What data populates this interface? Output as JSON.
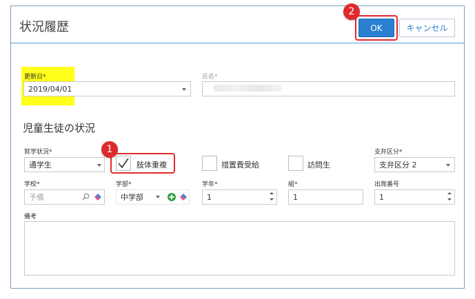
{
  "dialog": {
    "title": "状況履歴",
    "ok_label": "OK",
    "cancel_label": "キャンセル"
  },
  "annotations": {
    "badge_1": "1",
    "badge_2": "2",
    "highlight_color": "#ffff19",
    "marker_color": "#e0282b"
  },
  "form": {
    "update_date": {
      "label": "更新日*",
      "value": "2019/04/01"
    },
    "name": {
      "label": "氏名*",
      "value": ""
    },
    "section_title": "児童生徒の状況",
    "enrollment_status": {
      "label": "就学状況*",
      "value": "通学生"
    },
    "checkboxes": [
      {
        "label": "肢体重複",
        "checked": true
      },
      {
        "label": "措置費受給",
        "checked": false
      },
      {
        "label": "訪問生",
        "checked": false
      }
    ],
    "support_category": {
      "label": "支弁区分*",
      "value": "支弁区分 2"
    },
    "school": {
      "label": "学校*",
      "placeholder": "予備"
    },
    "department": {
      "label": "学部*",
      "value": "中学部"
    },
    "grade": {
      "label": "学年*",
      "value": "1"
    },
    "class": {
      "label": "組*",
      "value": "1"
    },
    "attendance_number": {
      "label": "出席番号",
      "value": "1"
    },
    "remarks": {
      "label": "備考",
      "value": ""
    }
  },
  "colors": {
    "primary": "#2a7fd1",
    "header_border": "#5b9bd5"
  }
}
